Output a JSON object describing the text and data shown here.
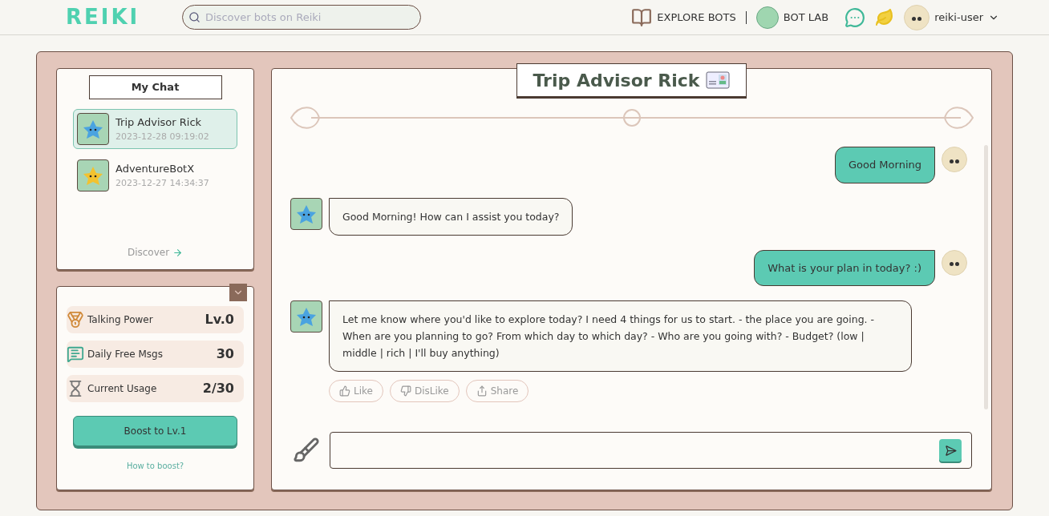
{
  "header": {
    "logo": "REIKI",
    "search": {
      "placeholder": "Discover bots on Reiki"
    },
    "nav": [
      {
        "label": "EXPLORE BOTS",
        "kind": "book"
      },
      {
        "label": "BOT LAB",
        "kind": "bot"
      }
    ],
    "user": "reiki-user"
  },
  "sidebar": {
    "title": "My Chat",
    "chats": [
      {
        "name": "Trip Advisor Rick",
        "time": "2023-12-28 09:19:02",
        "selected": true,
        "color": "#4aa3e0"
      },
      {
        "name": "AdventureBotX",
        "time": "2023-12-27 14:34:37",
        "selected": false,
        "color": "#f2c230"
      }
    ],
    "discover": "Discover"
  },
  "stats": {
    "items": [
      {
        "kind": "medal",
        "label": "Talking Power",
        "value": "Lv.0"
      },
      {
        "kind": "message",
        "label": "Daily Free Msgs",
        "value": "30"
      },
      {
        "kind": "hourglass",
        "label": "Current Usage",
        "value": "2/30"
      }
    ],
    "boost_button": "Boost to Lv.1",
    "help_link": "How to boost?"
  },
  "chat": {
    "title": "Trip Advisor Rick",
    "messages": [
      {
        "kind": "user",
        "text": "Good Morning"
      },
      {
        "kind": "bot",
        "text": "Good Morning! How can I assist you today?"
      },
      {
        "kind": "user",
        "text": "What is your plan in today? :)"
      },
      {
        "kind": "bot",
        "text": "Let me know where you'd like to explore today? I need 4 things for us to start. - the place you are going. - When are you planning to go? From which day to which day? - Who are you going with? - Budget? (low | middle | rich | I'll buy anything)"
      }
    ],
    "actions": [
      {
        "kind": "like",
        "label": "Like"
      },
      {
        "kind": "dislike",
        "label": "DisLike"
      },
      {
        "kind": "share",
        "label": "Share"
      }
    ]
  }
}
